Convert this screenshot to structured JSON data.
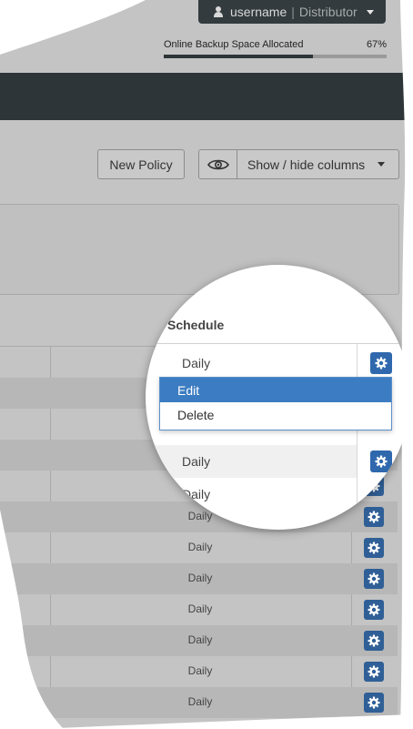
{
  "header": {
    "username": "username",
    "separator": "|",
    "role": "Distributor"
  },
  "backup": {
    "label": "Online Backup Space Allocated",
    "percent_text": "67%",
    "percent_value": 0.67
  },
  "toolbar": {
    "new_policy_label": "New Policy",
    "show_hide_label": "Show / hide columns"
  },
  "table": {
    "column_header": "Schedule",
    "rows": [
      "Daily",
      "Daily",
      "Daily",
      "Daily",
      "Daily",
      "Daily",
      "Daily",
      "Daily",
      "Daily",
      "Daily",
      "Daily",
      "Daily"
    ]
  },
  "magnifier": {
    "rows": [
      "Daily",
      "Daily",
      "Daily"
    ]
  },
  "dropdown": {
    "items": [
      "Edit",
      "Delete"
    ],
    "active_index": 0
  },
  "colors": {
    "navbar": "#2d3538",
    "accent": "#2f68ad",
    "menu_active": "#3c7cc2"
  }
}
